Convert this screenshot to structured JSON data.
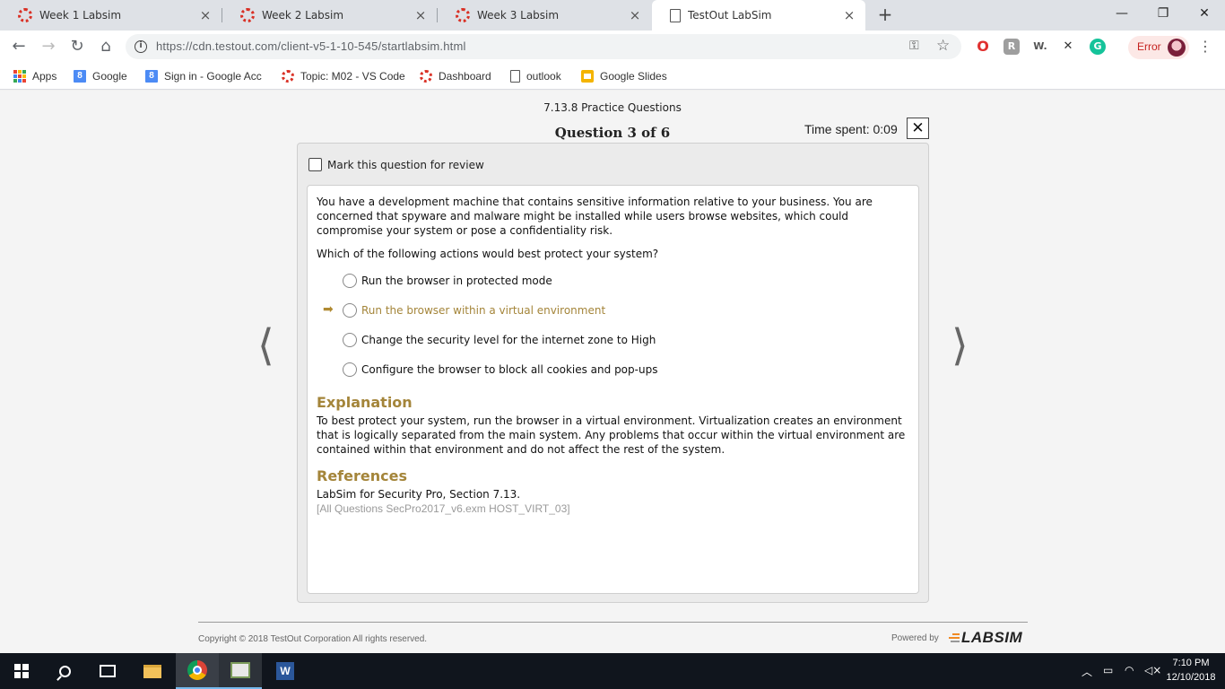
{
  "browser": {
    "tabs": [
      {
        "label": "Week 1 Labsim",
        "close": "×"
      },
      {
        "label": "Week 2 Labsim",
        "close": "×"
      },
      {
        "label": "Week 3 Labsim",
        "close": "×"
      },
      {
        "label": "TestOut LabSim",
        "close": "×"
      }
    ],
    "new_tab": "+",
    "window_controls": {
      "minimize": "—",
      "restore": "❐",
      "close": "✕"
    },
    "url": "https://cdn.testout.com/client-v5-1-10-545/startlabsim.html",
    "profile_status": "Error",
    "extensions": [
      "opera-icon",
      "reader-icon",
      "word-icon",
      "tool-icon",
      "grammarly-icon"
    ]
  },
  "bookmarks": [
    {
      "label": "Apps",
      "icon": "apps-grid-icon"
    },
    {
      "label": "Google",
      "icon": "google-icon"
    },
    {
      "label": "Sign in - Google Acc",
      "icon": "google-icon"
    },
    {
      "label": "Topic: M02 - VS Code",
      "icon": "labsim-icon"
    },
    {
      "label": "Dashboard",
      "icon": "labsim-icon"
    },
    {
      "label": "outlook",
      "icon": "page-icon"
    },
    {
      "label": "Google Slides",
      "icon": "slides-icon"
    }
  ],
  "quiz": {
    "module_title": "7.13.8 Practice Questions",
    "question_counter": "Question 3 of 6",
    "time_spent": "Time spent: 0:09",
    "close_label": "✕",
    "mark_review_label": "Mark this question for review",
    "question_text": "You have a development machine that contains sensitive information relative to your business. You are concerned that spyware and malware might be installed while users browse websites, which could compromise your system or pose a confidentiality risk.",
    "prompt": "Which of the following actions would best protect your system?",
    "choices": [
      {
        "label": "Run the browser in protected mode",
        "correct": false
      },
      {
        "label": "Run the browser within a virtual environment",
        "correct": true
      },
      {
        "label": "Change the security level for the internet zone to High",
        "correct": false
      },
      {
        "label": "Configure the browser to block all cookies and pop-ups",
        "correct": false
      }
    ],
    "explanation_heading": "Explanation",
    "explanation_text": "To best protect your system, run the browser in a virtual environment. Virtualization creates an environment that is logically separated from the main system. Any problems that occur within the virtual environment are contained within that environment and do not affect the rest of the system.",
    "references_heading": "References",
    "reference_text": "LabSim for Security Pro, Section 7.13.",
    "reference_id": "[All Questions SecPro2017_v6.exm HOST_VIRT_03]",
    "prev_arrow": "⟨",
    "next_arrow": "⟩"
  },
  "footer": {
    "copyright": "Copyright © 2018  TestOut Corporation All rights reserved.",
    "powered_by": "Powered by",
    "logo_text": "LABSIM"
  },
  "taskbar": {
    "time": "7:10 PM",
    "date": "12/10/2018",
    "word_letter": "W"
  },
  "colors": {
    "accent_gold": "#a4853a",
    "tab_strip": "#dee1e6",
    "taskbar": "#10151d"
  }
}
